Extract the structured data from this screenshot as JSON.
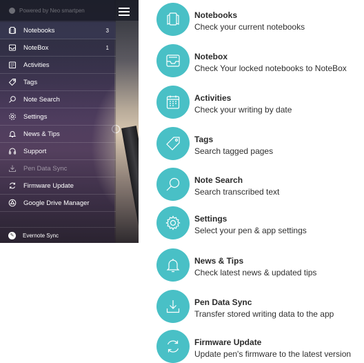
{
  "drawer": {
    "brand_text": "Powered by Neo smartpen",
    "items": [
      {
        "label": "Notebooks",
        "badge": "3",
        "icon": "notebook-icon"
      },
      {
        "label": "NoteBox",
        "badge": "1",
        "icon": "notebox-icon"
      },
      {
        "label": "Activities",
        "badge": "",
        "icon": "calendar-icon"
      },
      {
        "label": "Tags",
        "badge": "",
        "icon": "tag-icon"
      },
      {
        "label": "Note Search",
        "badge": "",
        "icon": "search-icon"
      },
      {
        "label": "Settings",
        "badge": "",
        "icon": "gear-icon"
      },
      {
        "label": "News & Tips",
        "badge": "",
        "icon": "bell-icon"
      },
      {
        "label": "Support",
        "badge": "",
        "icon": "headset-icon"
      },
      {
        "label": "Pen Data Sync",
        "badge": "",
        "icon": "download-icon"
      },
      {
        "label": "Firmware Update",
        "badge": "",
        "icon": "refresh-icon"
      },
      {
        "label": "Google Drive Manager",
        "badge": "",
        "icon": "drive-icon"
      }
    ],
    "evernote_label": "Evernote Sync"
  },
  "features": [
    {
      "title": "Notebooks",
      "desc": "Check your current notebooks",
      "icon": "notebook-icon"
    },
    {
      "title": "Notebox",
      "desc": "Check Your locked notebooks to NoteBox",
      "icon": "notebox-icon"
    },
    {
      "title": "Activities",
      "desc": "Check your writing by date",
      "icon": "calendar-icon"
    },
    {
      "title": "Tags",
      "desc": "Search tagged pages",
      "icon": "tag-icon"
    },
    {
      "title": "Note Search",
      "desc": "Search transcribed text",
      "icon": "search-icon"
    },
    {
      "title": "Settings",
      "desc": "Select your pen & app settings",
      "icon": "gear-icon"
    },
    {
      "title": "News & Tips",
      "desc": "Check latest news & updated tips",
      "icon": "bell-icon"
    },
    {
      "title": "Pen Data Sync",
      "desc": "Transfer stored writing data to the app",
      "icon": "download-icon"
    },
    {
      "title": "Firmware Update",
      "desc": "Update pen's firmware to the latest version",
      "icon": "refresh-icon"
    }
  ],
  "colors": {
    "accent": "#49c0c6"
  }
}
